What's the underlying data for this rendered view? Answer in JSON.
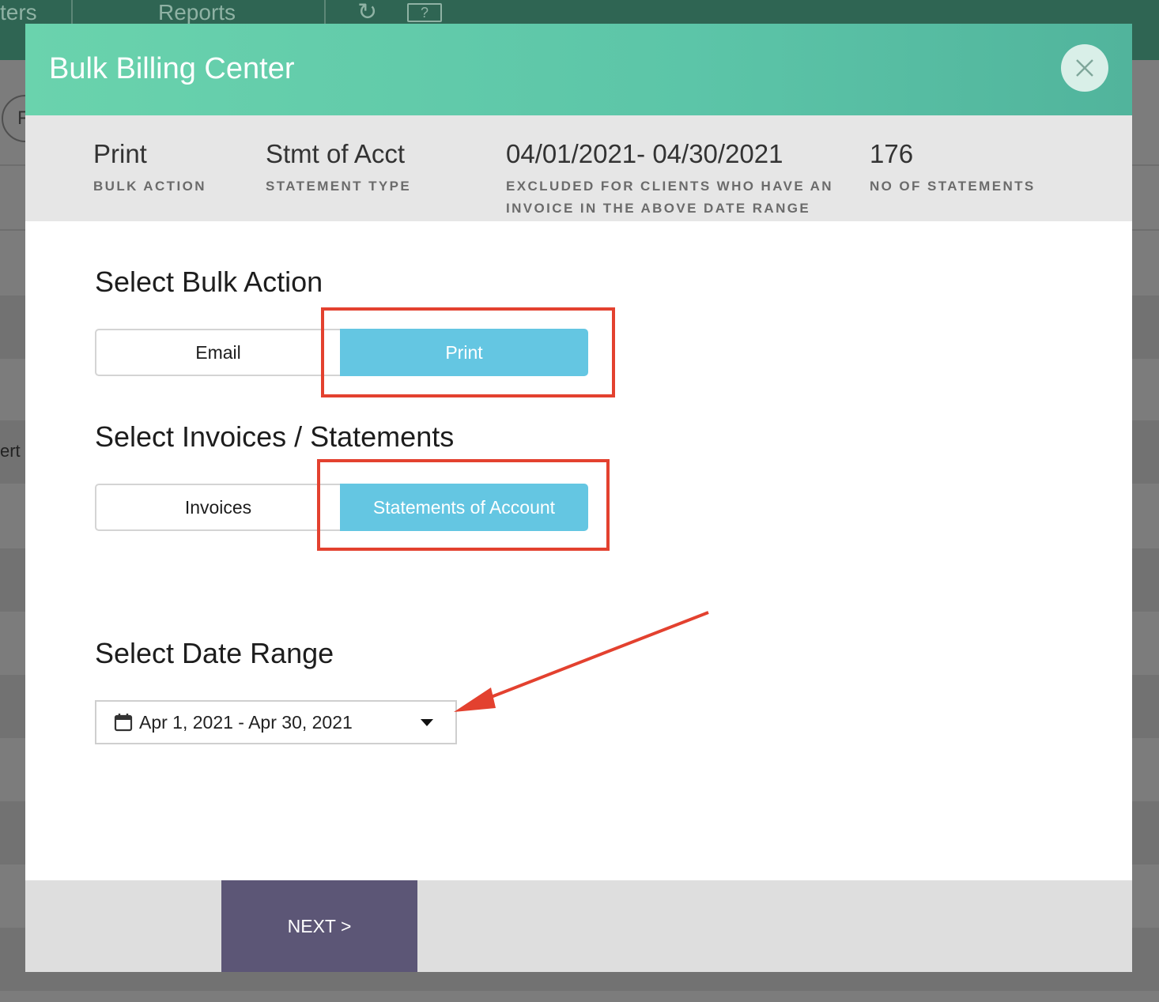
{
  "background": {
    "tabs": [
      "ters",
      "Reports"
    ],
    "side_text": "ert",
    "pill_text": "F"
  },
  "modal": {
    "title": "Bulk Billing Center",
    "close_icon": "close-icon"
  },
  "summary": [
    {
      "value": "Print",
      "label": "BULK ACTION"
    },
    {
      "value": "Stmt of Acct",
      "label": "STATEMENT TYPE"
    },
    {
      "value": "04/01/2021- 04/30/2021",
      "label": "EXCLUDED FOR CLIENTS WHO HAVE AN INVOICE IN THE ABOVE DATE RANGE"
    },
    {
      "value": "176",
      "label": "NO OF STATEMENTS"
    }
  ],
  "bulk_action": {
    "title": "Select Bulk Action",
    "options": [
      "Email",
      "Print"
    ],
    "selected": "Print"
  },
  "doc_type": {
    "title": "Select Invoices / Statements",
    "options": [
      "Invoices",
      "Statements of Account"
    ],
    "selected": "Statements of Account"
  },
  "date_range": {
    "title": "Select Date Range",
    "value": "Apr 1, 2021 - Apr 30, 2021",
    "icon": "calendar-icon"
  },
  "footer": {
    "next_label": "NEXT >"
  },
  "colors": {
    "header_gradient_start": "#6ad3ad",
    "header_gradient_end": "#51b49c",
    "selected_option": "#64c6e2",
    "next_button": "#5c5676",
    "annotation_red": "#e3412f"
  }
}
